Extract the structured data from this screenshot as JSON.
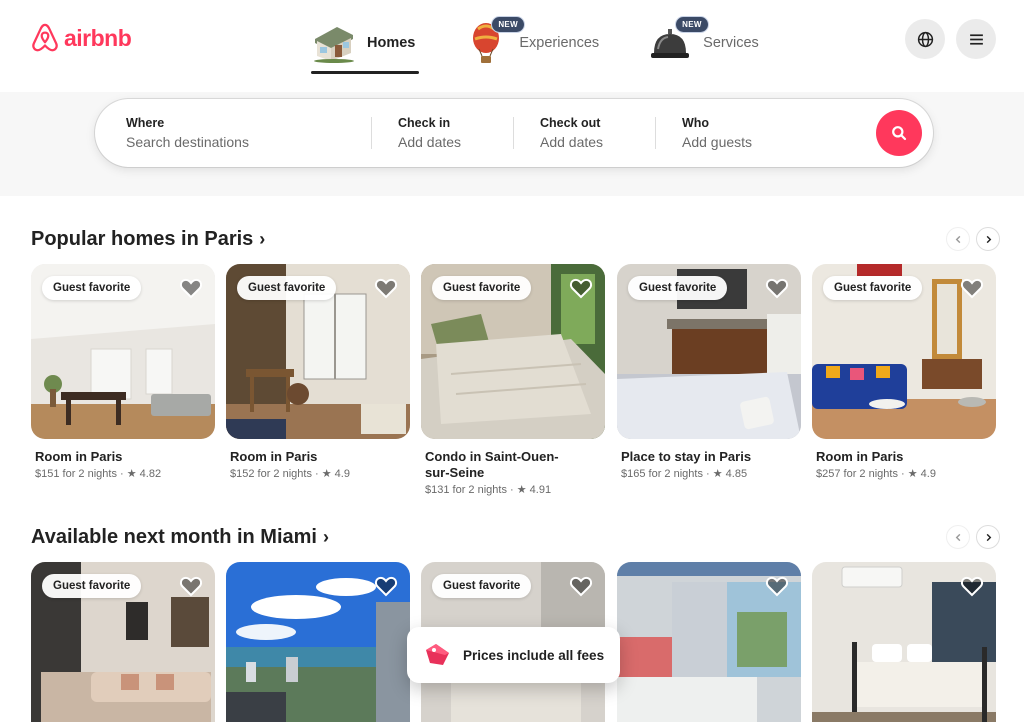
{
  "brand": {
    "name": "airbnb",
    "color": "#ff385c"
  },
  "categories": [
    {
      "label": "Homes",
      "icon": "house-icon",
      "active": true,
      "badge": ""
    },
    {
      "label": "Experiences",
      "icon": "hot-air-balloon-icon",
      "active": false,
      "badge": "NEW"
    },
    {
      "label": "Services",
      "icon": "service-bell-icon",
      "active": false,
      "badge": "NEW"
    }
  ],
  "header_buttons": {
    "language": "globe-icon",
    "menu": "hamburger-menu-icon"
  },
  "search": {
    "where": {
      "label": "Where",
      "placeholder": "Search destinations"
    },
    "checkin": {
      "label": "Check in",
      "placeholder": "Add dates"
    },
    "checkout": {
      "label": "Check out",
      "placeholder": "Add dates"
    },
    "who": {
      "label": "Who",
      "placeholder": "Add guests"
    },
    "button_icon": "search-icon"
  },
  "sections": [
    {
      "title": "Popular homes in Paris",
      "chevron": "›",
      "listings": [
        {
          "badge": "Guest favorite",
          "title": "Room in Paris",
          "price": "$151 for 2 nights",
          "rating": "★ 4.82"
        },
        {
          "badge": "Guest favorite",
          "title": "Room in Paris",
          "price": "$152 for 2 nights",
          "rating": "★ 4.9"
        },
        {
          "badge": "Guest favorite",
          "title": "Condo in Saint-Ouen-sur-Seine",
          "price": "$131 for 2 nights",
          "rating": "★ 4.91"
        },
        {
          "badge": "Guest favorite",
          "title": "Place to stay in Paris",
          "price": "$165 for 2 nights",
          "rating": "★ 4.85"
        },
        {
          "badge": "Guest favorite",
          "title": "Room in Paris",
          "price": "$257 for 2 nights",
          "rating": "★ 4.9"
        }
      ]
    },
    {
      "title": "Available next month in Miami",
      "chevron": "›",
      "listings": [
        {
          "badge": "Guest favorite"
        },
        {
          "badge": ""
        },
        {
          "badge": "Guest favorite"
        },
        {
          "badge": ""
        },
        {
          "badge": ""
        }
      ]
    }
  ],
  "fees_pill": {
    "text": "Prices include all fees",
    "icon": "price-tag-icon"
  }
}
